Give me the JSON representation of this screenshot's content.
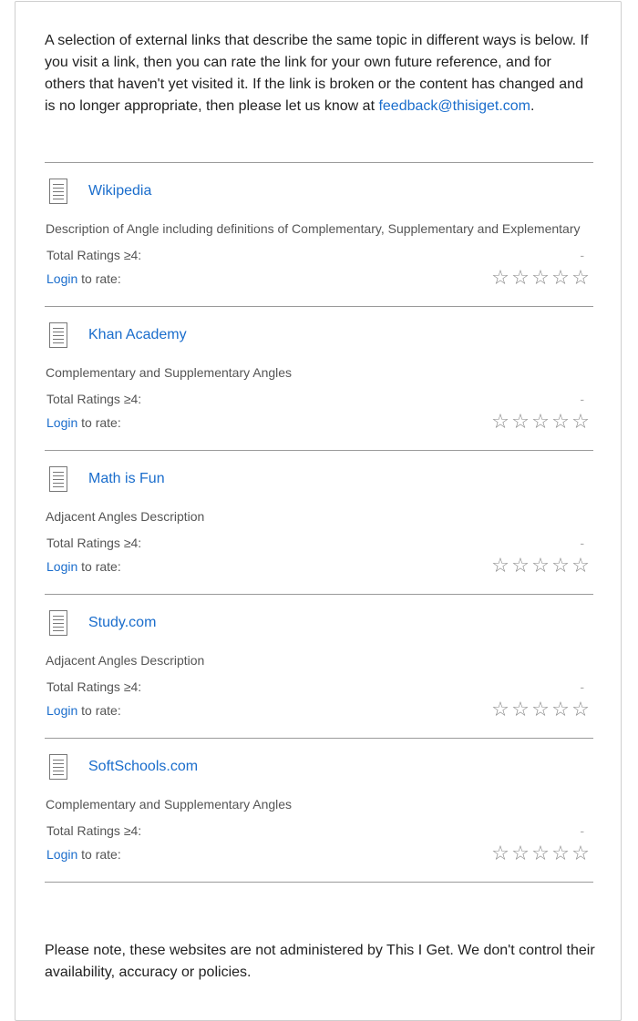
{
  "intro": {
    "text": "A selection of external links that describe the same topic in different ways is below. If you visit a link, then you can rate the link for your own future reference, and for others that haven't yet visited it. If the link is broken or the content has changed and is no longer appropriate, then please let us know at ",
    "email": "feedback@thisiget.com",
    "period": "."
  },
  "common": {
    "ratings_label": "Total Ratings ≥4:",
    "ratings_value": "-",
    "login_label": "Login",
    "to_rate_label": " to rate:",
    "star_glyph": "☆"
  },
  "links": [
    {
      "title": "Wikipedia",
      "description": "Description of Angle including definitions of Complementary, Supplementary and Explementary"
    },
    {
      "title": "Khan Academy",
      "description": "Complementary and Supplementary Angles"
    },
    {
      "title": "Math is Fun",
      "description": "Adjacent Angles Description"
    },
    {
      "title": "Study.com",
      "description": "Adjacent Angles Description"
    },
    {
      "title": "SoftSchools.com",
      "description": "Complementary and Supplementary Angles"
    }
  ],
  "footer": {
    "text": "Please note, these websites are not administered by This I Get. We don't control their availability, accuracy or policies."
  },
  "colors": {
    "link": "#1a6dcc",
    "divider": "#9a9a9a",
    "star": "#888888"
  }
}
